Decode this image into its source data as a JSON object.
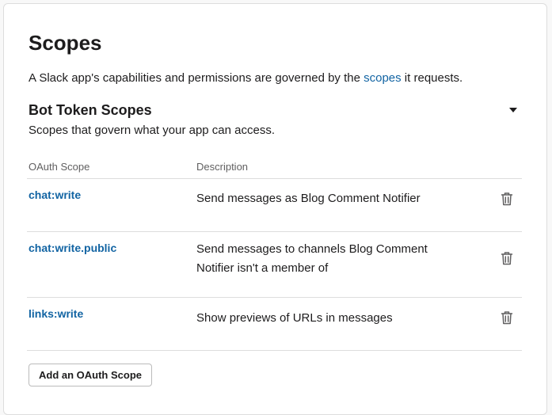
{
  "page": {
    "title": "Scopes",
    "intro_before": "A Slack app's capabilities and permissions are governed by the ",
    "intro_link": "scopes",
    "intro_after": " it requests."
  },
  "bot_scopes": {
    "title": "Bot Token Scopes",
    "description": "Scopes that govern what your app can access.",
    "toggle_icon": "caret-down-icon",
    "columns": [
      "OAuth Scope",
      "Description"
    ],
    "rows": [
      {
        "scope": "chat:write",
        "description": "Send messages as Blog Comment Notifier",
        "action_icon": "trash-icon"
      },
      {
        "scope": "chat:write.public",
        "description": "Send messages to channels Blog Comment Notifier isn't a member of",
        "action_icon": "trash-icon"
      },
      {
        "scope": "links:write",
        "description": "Show previews of URLs in messages",
        "action_icon": "trash-icon"
      }
    ],
    "add_button_label": "Add an OAuth Scope"
  },
  "colors": {
    "link": "#1264a3",
    "text": "#1d1c1d",
    "muted": "#616061",
    "divider": "#dddddd"
  }
}
